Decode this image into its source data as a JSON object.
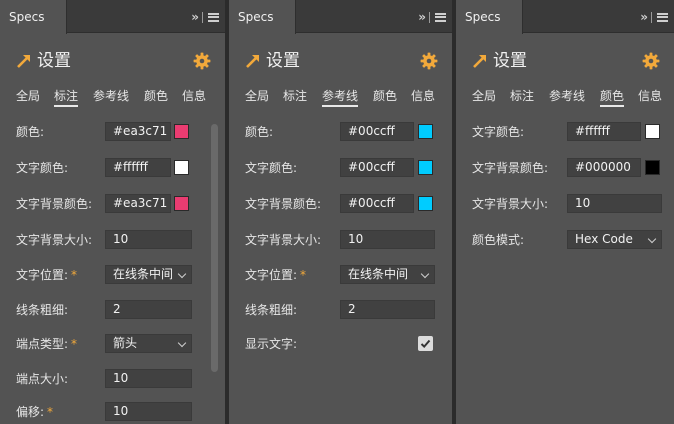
{
  "colors": {
    "accent": "#f2a93b",
    "panel_bg": "#535353",
    "field_bg": "#414141"
  },
  "icons": {
    "header": "arrow-diagonal-icon",
    "settings": "gear-icon",
    "collapse": "double-chevron-right-icon",
    "menu": "hamburger-menu-icon"
  },
  "panels": [
    {
      "tab": "Specs",
      "collapse": "»",
      "title": "设置",
      "tabs": [
        "全局",
        "标注",
        "参考线",
        "颜色",
        "信息"
      ],
      "active_tab": 1,
      "rows": [
        {
          "label": "颜色:",
          "required": false,
          "value": "#ea3c71",
          "swatch": "#ea3c71"
        },
        {
          "label": "文字颜色:",
          "required": false,
          "value": "#ffffff",
          "swatch": "#ffffff"
        },
        {
          "label": "文字背景颜色:",
          "required": false,
          "value": "#ea3c71",
          "swatch": "#ea3c71"
        },
        {
          "label": "文字背景大小:",
          "required": false,
          "value": "10"
        },
        {
          "label": "文字位置:",
          "required": true,
          "value": "在线条中间",
          "select": true
        },
        {
          "label": "线条粗细:",
          "required": false,
          "value": "2"
        },
        {
          "label": "端点类型:",
          "required": true,
          "value": "箭头",
          "select": true
        },
        {
          "label": "端点大小:",
          "required": false,
          "value": "10"
        },
        {
          "label": "偏移:",
          "required": true,
          "value": "10"
        }
      ]
    },
    {
      "tab": "Specs",
      "collapse": "»",
      "title": "设置",
      "tabs": [
        "全局",
        "标注",
        "参考线",
        "颜色",
        "信息"
      ],
      "active_tab": 2,
      "rows": [
        {
          "label": "颜色:",
          "required": false,
          "value": "#00ccff",
          "swatch": "#00ccff"
        },
        {
          "label": "文字颜色:",
          "required": false,
          "value": "#00ccff",
          "swatch": "#00ccff"
        },
        {
          "label": "文字背景颜色:",
          "required": false,
          "value": "#00ccff",
          "swatch": "#00ccff"
        },
        {
          "label": "文字背景大小:",
          "required": false,
          "value": "10"
        },
        {
          "label": "文字位置:",
          "required": true,
          "value": "在线条中间",
          "select": true
        },
        {
          "label": "线条粗细:",
          "required": false,
          "value": "2"
        },
        {
          "label": "显示文字:",
          "required": false,
          "checkbox": true,
          "checked": true
        }
      ]
    },
    {
      "tab": "Specs",
      "collapse": "»",
      "title": "设置",
      "tabs": [
        "全局",
        "标注",
        "参考线",
        "颜色",
        "信息"
      ],
      "active_tab": 3,
      "rows": [
        {
          "label": "文字颜色:",
          "required": false,
          "value": "#ffffff",
          "swatch": "#ffffff"
        },
        {
          "label": "文字背景颜色:",
          "required": false,
          "value": "#000000",
          "swatch": "#000000"
        },
        {
          "label": "文字背景大小:",
          "required": false,
          "value": "10"
        },
        {
          "label": "颜色模式:",
          "required": false,
          "value": "Hex Code",
          "select": true
        }
      ]
    }
  ]
}
